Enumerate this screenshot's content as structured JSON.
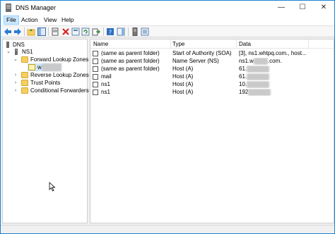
{
  "window": {
    "title": "DNS Manager"
  },
  "menu": [
    {
      "label": "File",
      "selected": true
    },
    {
      "label": "Action",
      "selected": false
    },
    {
      "label": "View",
      "selected": false
    },
    {
      "label": "Help",
      "selected": false
    }
  ],
  "window_controls": {
    "minimize": "—",
    "maximize": "☐",
    "close": "✕"
  },
  "tree": {
    "root": "DNS",
    "server": "NS1",
    "forward": "Forward Lookup Zones",
    "zone_prefix": "w",
    "zone_redacted": "xxxxxxx",
    "reverse": "Reverse Lookup Zones",
    "trust": "Trust Points",
    "conditional": "Conditional Forwarders",
    "expand_open": "⌄",
    "expand_closed": "›"
  },
  "list": {
    "columns": [
      "Name",
      "Type",
      "Data"
    ],
    "rows": [
      {
        "name": "(same as parent folder)",
        "type": "Start of Authority (SOA)",
        "data": "[3], ns1.whtpq.com., host...",
        "redacted": ""
      },
      {
        "name": "(same as parent folder)",
        "type": "Name Server (NS)",
        "data": "ns1.w",
        "redacted": "xxxxx",
        "data_suffix": ".com."
      },
      {
        "name": "(same as parent folder)",
        "type": "Host (A)",
        "data": "61.",
        "redacted": "xxxxxxxx"
      },
      {
        "name": "mail",
        "type": "Host (A)",
        "data": "61.",
        "redacted": "xxxxxxxx"
      },
      {
        "name": "ns1",
        "type": "Host (A)",
        "data": "10.",
        "redacted": "xxxxxxxx"
      },
      {
        "name": "ns1",
        "type": "Host (A)",
        "data": "192",
        "redacted": "xxxxxxxx"
      }
    ]
  },
  "colors": {
    "accent": "#1883d7",
    "selection": "#cce8ff",
    "folder": "#f4cf61"
  }
}
